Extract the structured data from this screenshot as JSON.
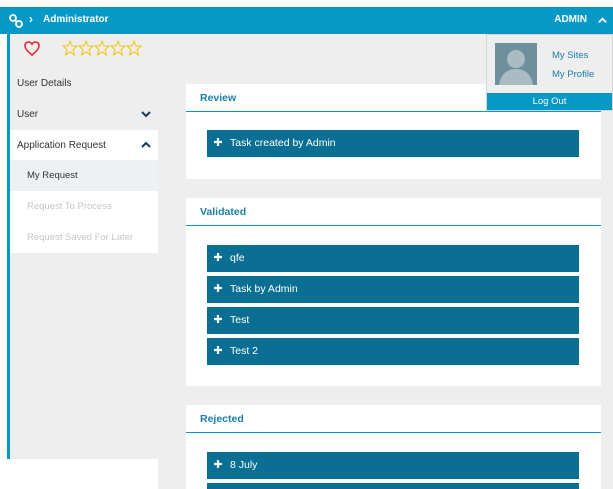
{
  "topbar": {
    "title": "Administrator",
    "user": "ADMIN"
  },
  "rating": {
    "stars_total": 5,
    "stars_filled": 0
  },
  "sidebar": {
    "user_details": "User Details",
    "user": "User",
    "application_request": "Application Request",
    "items": [
      {
        "label": "My Request",
        "state": "active"
      },
      {
        "label": "Request To Process",
        "state": "disabled"
      },
      {
        "label": "Request Saved For Later",
        "state": "disabled"
      }
    ]
  },
  "user_menu": {
    "my_sites": "My Sites",
    "my_profile": "My Profile",
    "log_out": "Log Out"
  },
  "sections": [
    {
      "title": "Review",
      "tasks": [
        "Task created by Admin"
      ]
    },
    {
      "title": "Validated",
      "tasks": [
        "qfe",
        "Task by Admin",
        "Test",
        "Test 2"
      ]
    },
    {
      "title": "Rejected",
      "tasks": [
        "8 July"
      ]
    }
  ],
  "colors": {
    "accent": "#0799c6",
    "task_bar": "#0a6f92",
    "heading": "#1a7fa7"
  }
}
